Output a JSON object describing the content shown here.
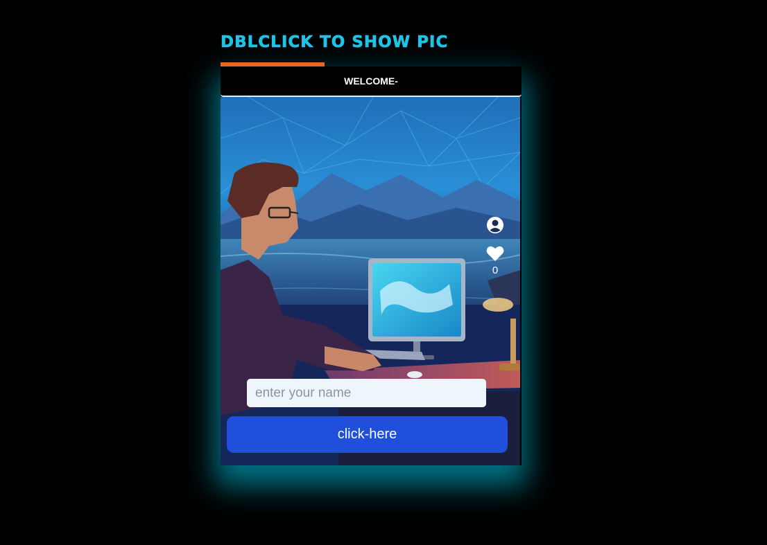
{
  "header": {
    "title": "DBLCLICK TO SHOW PIC"
  },
  "card": {
    "welcome_text": "WELCOME-"
  },
  "actions": {
    "profile_icon": "user-circle-icon",
    "like_icon": "heart-icon",
    "like_count": "0"
  },
  "form": {
    "name_placeholder": "enter your name",
    "name_value": "",
    "button_label": "click-here"
  },
  "colors": {
    "title": "#1fc4e6",
    "accent_bar": "#ff5a12",
    "button": "#1f4fdb",
    "glow": "#00d2f0"
  }
}
